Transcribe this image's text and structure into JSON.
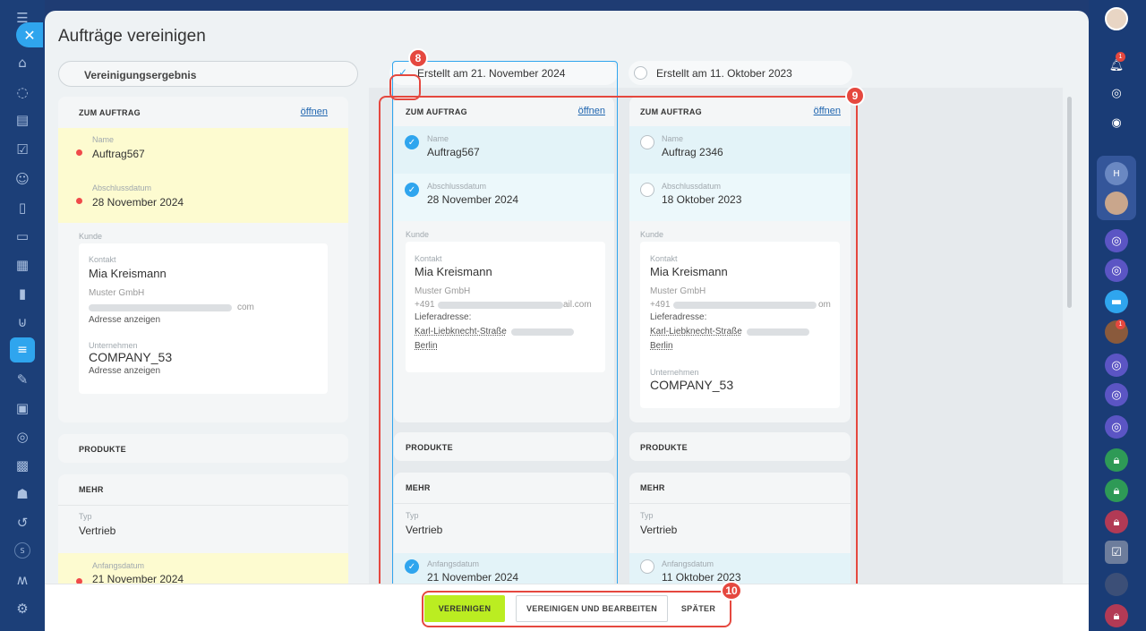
{
  "window": {
    "title": "Aufträge vereinigen"
  },
  "merge_result": {
    "label": "Vereinigungsergebnis"
  },
  "colors": {
    "accent": "#2fa5ee",
    "highlight": "#e5483f",
    "merge_button": "#bbed21"
  },
  "icons": {
    "left_sidebar": [
      "menu-icon",
      "close-icon",
      "home-icon",
      "tasks-icon",
      "chat-icon",
      "check-icon",
      "contacts-icon",
      "document-icon",
      "card-icon",
      "presentation-icon",
      "analytics-icon",
      "cart-icon",
      "filter-icon",
      "edit-icon",
      "news-icon",
      "contacts-book-icon",
      "calendar-icon",
      "robot-icon",
      "signature-icon",
      "s-icon",
      "logo-icon",
      "settings-icon"
    ],
    "right_sidebar": [
      "avatar-icon",
      "notifications-icon",
      "gear-icon",
      "copilot-icon",
      "h-avatar-icon",
      "avatar-icon",
      "channel-icon",
      "channel-icon",
      "chat-icon",
      "avatar-icon",
      "channel-icon",
      "channel-icon",
      "channel-icon",
      "lock-icon",
      "lock-icon",
      "lock-icon",
      "checklist-icon",
      "avatar-icon",
      "lock-icon"
    ]
  },
  "result_column": {
    "section_title": "ZUM AUFTRAG",
    "open_link": "öffnen",
    "fields": [
      {
        "label": "Name",
        "value": "Auftrag567"
      },
      {
        "label": "Abschlussdatum",
        "value": "28 November 2024"
      }
    ],
    "customer": {
      "label": "Kunde",
      "contact_label": "Kontakt",
      "contact_name": "Mia Kreismann",
      "company_text": "Muster GmbH",
      "email_tail": "com",
      "address_link": "Adresse anzeigen",
      "company_label": "Unternehmen",
      "company_name": "COMPANY_53",
      "company_address_link": "Adresse anzeigen"
    },
    "products_title": "PRODUKTE",
    "more_title": "MEHR",
    "type_label": "Typ",
    "type_value": "Vertrieb",
    "start_label": "Anfangsdatum",
    "start_value": "21 November 2024"
  },
  "source_columns": [
    {
      "tab_label": "Erstellt am 21. November 2024",
      "selected": true,
      "section_title": "ZUM AUFTRAG",
      "open_link": "öffnen",
      "name_label": "Name",
      "name_value": "Auftrag567",
      "date_label": "Abschlussdatum",
      "date_value": "28 November 2024",
      "customer_label": "Kunde",
      "contact_label": "Kontakt",
      "contact_name": "Mia Kreismann",
      "company_text": "Muster GmbH",
      "phone_prefix": "+491",
      "email_tail": "ail.com",
      "delivery_label": "Lieferadresse:",
      "street": "Karl-Liebknecht-Straße",
      "city": "Berlin",
      "products_title": "PRODUKTE",
      "more_title": "MEHR",
      "type_label": "Typ",
      "type_value": "Vertrieb",
      "start_label": "Anfangsdatum",
      "start_value": "21 November 2024"
    },
    {
      "tab_label": "Erstellt am 11. Oktober 2023",
      "selected": false,
      "section_title": "ZUM AUFTRAG",
      "open_link": "öffnen",
      "name_label": "Name",
      "name_value": "Auftrag 2346",
      "date_label": "Abschlussdatum",
      "date_value": "18 Oktober 2023",
      "customer_label": "Kunde",
      "contact_label": "Kontakt",
      "contact_name": "Mia Kreismann",
      "company_text": "Muster GmbH",
      "phone_prefix": "+491",
      "email_tail": "om",
      "delivery_label": "Lieferadresse:",
      "street": "Karl-Liebknecht-Straße",
      "city": "Berlin",
      "company_label": "Unternehmen",
      "company_name": "COMPANY_53",
      "products_title": "PRODUKTE",
      "more_title": "MEHR",
      "type_label": "Typ",
      "type_value": "Vertrieb",
      "start_label": "Anfangsdatum",
      "start_value": "11 Oktober 2023"
    }
  ],
  "annotations": {
    "badge_8": "8",
    "badge_9": "9",
    "badge_10": "10"
  },
  "footer": {
    "merge": "VEREINIGEN",
    "merge_edit": "VEREINIGEN UND BEARBEITEN",
    "later": "SPÄTER"
  }
}
